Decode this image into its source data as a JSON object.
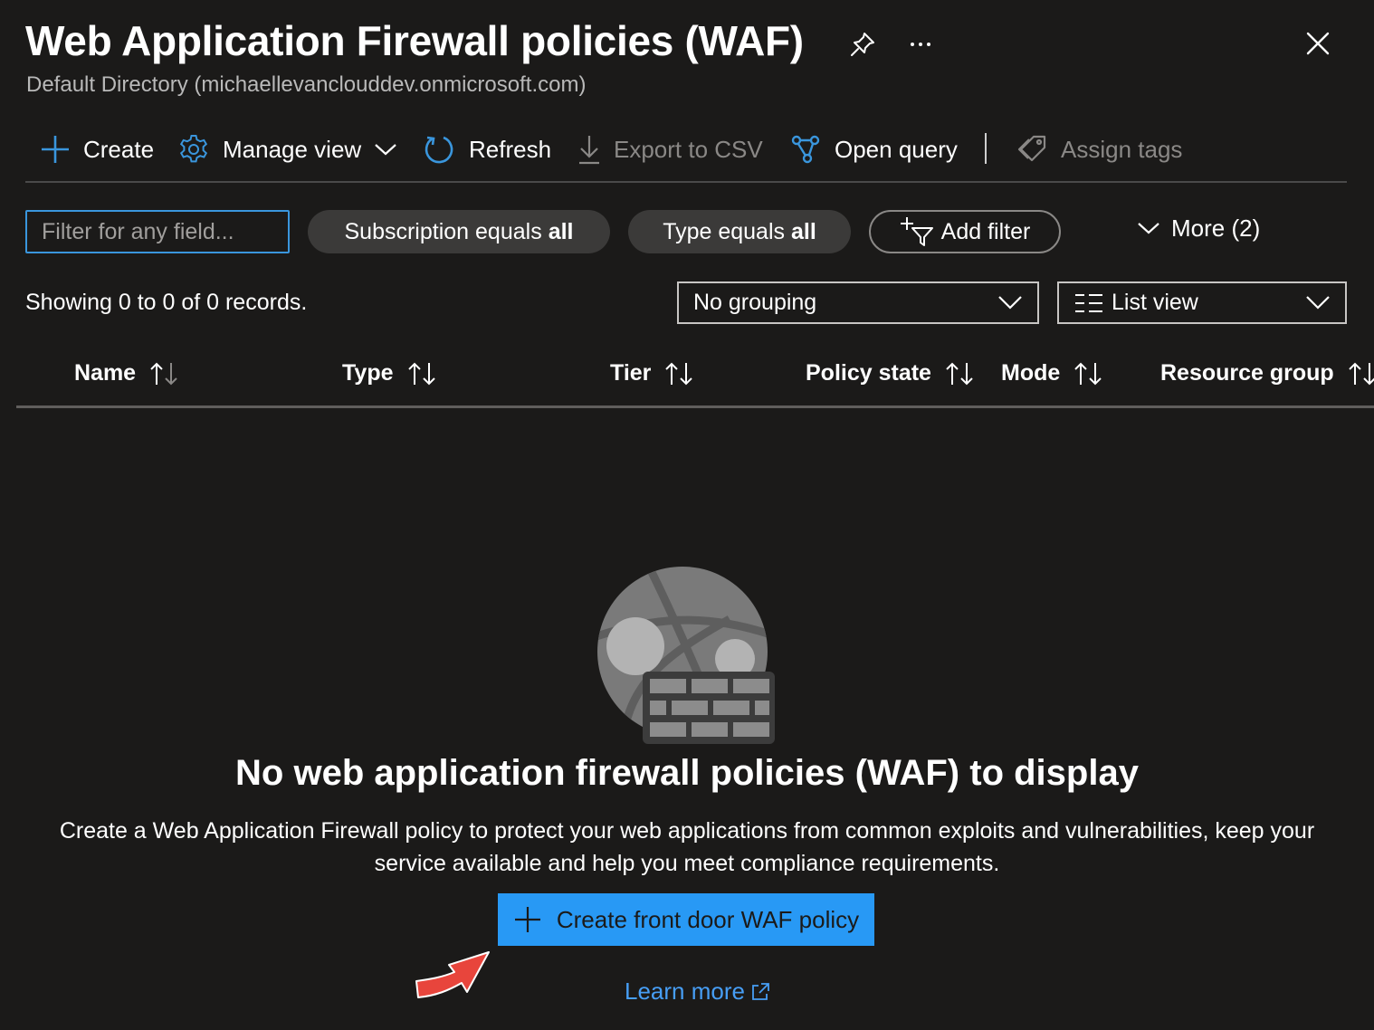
{
  "header": {
    "title": "Web Application Firewall policies (WAF)",
    "subtitle": "Default Directory (michaellevanclouddev.onmicrosoft.com)",
    "icons": [
      "pin-icon",
      "more-icon",
      "close-icon"
    ]
  },
  "toolbar": {
    "create": "Create",
    "manage_view": "Manage view",
    "refresh": "Refresh",
    "export_csv": "Export to CSV",
    "open_query": "Open query",
    "assign_tags": "Assign tags"
  },
  "filters": {
    "search_placeholder": "Filter for any field...",
    "subscription_prefix": "Subscription equals",
    "subscription_value": "all",
    "type_prefix": "Type equals",
    "type_value": "all",
    "add_filter": "Add filter",
    "more": "More (2)"
  },
  "records": {
    "summary": "Showing 0 to 0 of 0 records.",
    "grouping": "No grouping",
    "view": "List view"
  },
  "table": {
    "columns": [
      "Name",
      "Type",
      "Tier",
      "Policy state",
      "Mode",
      "Resource group"
    ],
    "rows": []
  },
  "empty_state": {
    "title": "No web application firewall policies (WAF) to display",
    "description": "Create a Web Application Firewall policy to protect your web applications from common exploits and vulnerabilities, keep your service available and help you meet compliance requirements.",
    "cta": "Create front door WAF policy",
    "learn_more": "Learn more"
  },
  "colors": {
    "background": "#1b1a19",
    "accent": "#2899f5",
    "link": "#479ef5",
    "annotation_arrow": "#e8453c"
  }
}
